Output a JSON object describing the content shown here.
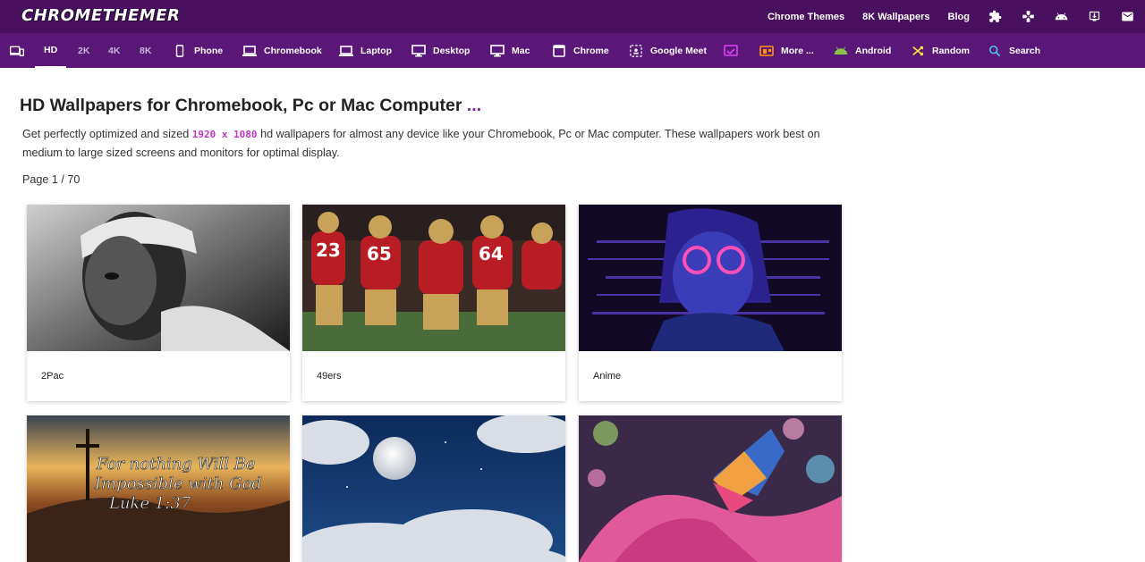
{
  "header": {
    "logo": "CHROMETHEMER",
    "links": [
      "Chrome Themes",
      "8K Wallpapers",
      "Blog"
    ],
    "icons": [
      "puzzle-icon",
      "gamepad-icon",
      "android-icon",
      "download-icon",
      "mail-icon"
    ]
  },
  "nav": {
    "resolutions": [
      "HD",
      "2K",
      "4K",
      "8K"
    ],
    "active": "HD",
    "items": [
      {
        "label": "Phone",
        "icon": "phone-icon"
      },
      {
        "label": "Chromebook",
        "icon": "chromebook-icon"
      },
      {
        "label": "Laptop",
        "icon": "laptop-icon"
      },
      {
        "label": "Desktop",
        "icon": "desktop-icon"
      },
      {
        "label": "Mac",
        "icon": "mac-icon"
      },
      {
        "label": "Chrome",
        "icon": "chrome-window-icon"
      },
      {
        "label": "Google Meet",
        "icon": "google-meet-icon"
      },
      {
        "label": "More ...",
        "icon": "more-icon"
      },
      {
        "label": "Android",
        "icon": "android-icon"
      },
      {
        "label": "Random",
        "icon": "shuffle-icon"
      },
      {
        "label": "Search",
        "icon": "search-icon"
      }
    ]
  },
  "main": {
    "title": "HD Wallpapers for Chromebook, Pc or Mac Computer",
    "title_dots": "...",
    "intro_before": "Get perfectly optimized and sized",
    "resolution": "1920 x 1080",
    "intro_after": "hd wallpapers for almost any device like your Chromebook, Pc or Mac computer.   These wallpapers work best on medium to large sized screens and monitors for optimal display.",
    "pager": "Page 1 / 70"
  },
  "cards": [
    {
      "label": "2Pac"
    },
    {
      "label": "49ers"
    },
    {
      "label": "Anime"
    },
    {
      "label": "",
      "overlay_text": [
        "For nothing Will Be",
        "Impossible with God",
        "Luke 1:37"
      ]
    },
    {
      "label": ""
    },
    {
      "label": ""
    }
  ],
  "colors": {
    "topbar": "#4a1060",
    "navbar": "#5a1778",
    "accent": "#c035c4"
  }
}
